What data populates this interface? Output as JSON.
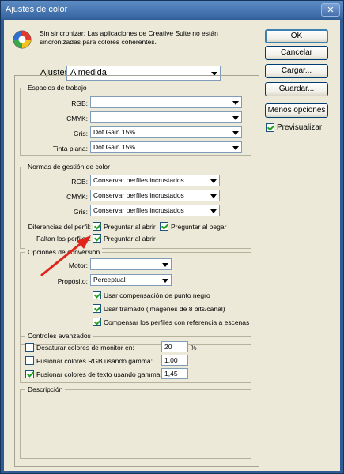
{
  "window": {
    "title": "Ajustes de color",
    "close_glyph": "✕"
  },
  "sync": {
    "message": "Sin sincronizar: Las aplicaciones de Creative Suite no están sincronizadas para colores coherentes."
  },
  "ajustes": {
    "label": "Ajustes:",
    "value": "A medida"
  },
  "work_spaces": {
    "legend": "Espacios de trabajo",
    "rgb": {
      "label": "RGB:",
      "value": ""
    },
    "cmyk": {
      "label": "CMYK:",
      "value": ""
    },
    "gris": {
      "label": "Gris:",
      "value": "Dot Gain 15%"
    },
    "tinta": {
      "label": "Tinta plana:",
      "value": "Dot Gain 15%"
    }
  },
  "policies": {
    "legend": "Normas de gestión de color",
    "rgb": {
      "label": "RGB:",
      "value": "Conservar perfiles incrustados"
    },
    "cmyk": {
      "label": "CMYK:",
      "value": "Conservar perfiles incrustados"
    },
    "gris": {
      "label": "Gris:",
      "value": "Conservar perfiles incrustados"
    },
    "mismatch": {
      "label": "Diferencias del perfil:",
      "ask_open": "Preguntar al abrir",
      "ask_paste": "Preguntar al pegar"
    },
    "missing": {
      "label": "Faltan los perfiles:",
      "ask_open": "Preguntar al abrir"
    }
  },
  "conversion": {
    "legend": "Opciones de conversión",
    "motor": {
      "label": "Motor:",
      "value": ""
    },
    "proposito": {
      "label": "Propósito:",
      "value": "Perceptual"
    },
    "bpc": "Usar compensación de punto negro",
    "dither": "Usar tramado (imágenes de 8 bits/canal)",
    "scene": "Compensar los perfiles con referencia a escenas"
  },
  "advanced": {
    "legend": "Controles avanzados",
    "desaturate": {
      "label": "Desaturar colores de monitor en:",
      "value": "20",
      "unit": "%"
    },
    "blend_rgb": {
      "label": "Fusionar colores RGB usando gamma:",
      "value": "1,00"
    },
    "blend_text": {
      "label": "Fusionar colores de texto usando gamma:",
      "value": "1,45"
    }
  },
  "description": {
    "legend": "Descripción"
  },
  "buttons": {
    "ok": "OK",
    "cancel": "Cancelar",
    "load": "Cargar...",
    "save": "Guardar...",
    "more": "Menos opciones",
    "preview": "Previsualizar"
  },
  "colors": {
    "titlebar": "#2f5d93",
    "dialog_bg": "#ece9d8",
    "annotation_arrow": "#e0241b"
  }
}
